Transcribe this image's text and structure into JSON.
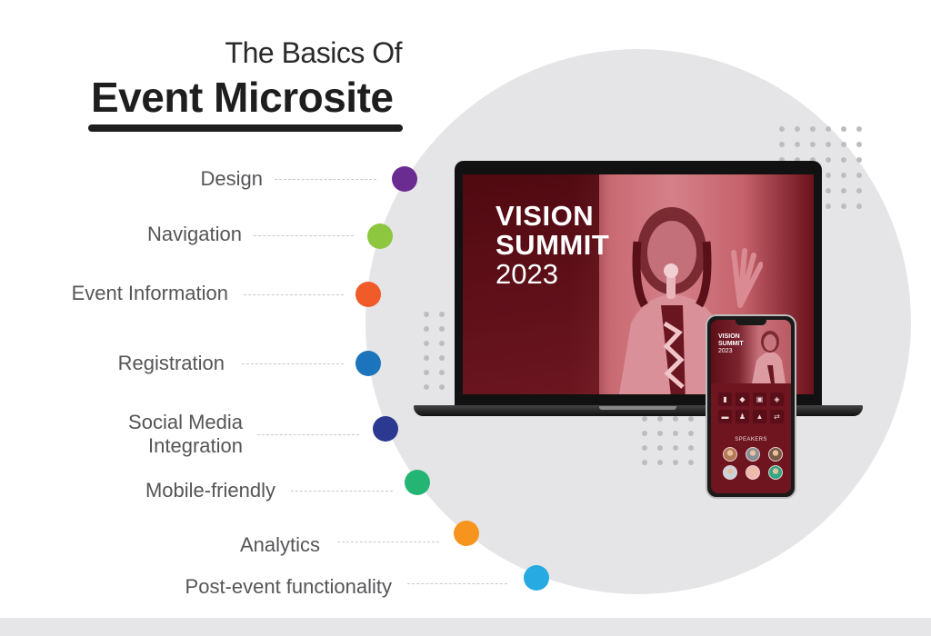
{
  "header": {
    "title_line1": "The Basics Of",
    "title_line2": "Event Microsite"
  },
  "features": [
    {
      "label": "Design",
      "color": "#6a2c91"
    },
    {
      "label": "Navigation",
      "color": "#8dc63f"
    },
    {
      "label": "Event Information",
      "color": "#f15a29"
    },
    {
      "label": "Registration",
      "color": "#1c75bc"
    },
    {
      "label": "Social Media Integration",
      "label_line1": "Social Media",
      "label_line2": "Integration",
      "color": "#2b3990"
    },
    {
      "label": "Mobile-friendly",
      "color": "#24b574"
    },
    {
      "label": "Analytics",
      "color": "#f7941d"
    },
    {
      "label": "Post-event functionality",
      "color": "#27aae1"
    }
  ],
  "laptop_screen": {
    "title": "VISION SUMMIT",
    "title_line1": "VISION",
    "title_line2": "SUMMIT",
    "year": "2023"
  },
  "phone_screen": {
    "title_line1": "VISION",
    "title_line2": "SUMMIT",
    "year": "2023",
    "icons": [
      "bar-chart-icon",
      "chat-icon",
      "message-icon",
      "chat-bubbles-icon",
      "schedule-icon",
      "speaker-icon",
      "podium-icon",
      "transfer-icon"
    ],
    "icon_glyphs": [
      "▮",
      "◆",
      "▣",
      "◈",
      "▬",
      "♟",
      "▲",
      "⇄"
    ],
    "speakers_label": "SPEAKERS",
    "avatar_colors": [
      "#b57a55",
      "#8a8f96",
      "#7a5b48",
      "#c9d3dc",
      "#f0b8b2",
      "#2fa883"
    ]
  },
  "colors": {
    "accent_maroon": "#6e1520",
    "circle_bg": "#e5e5e7"
  }
}
